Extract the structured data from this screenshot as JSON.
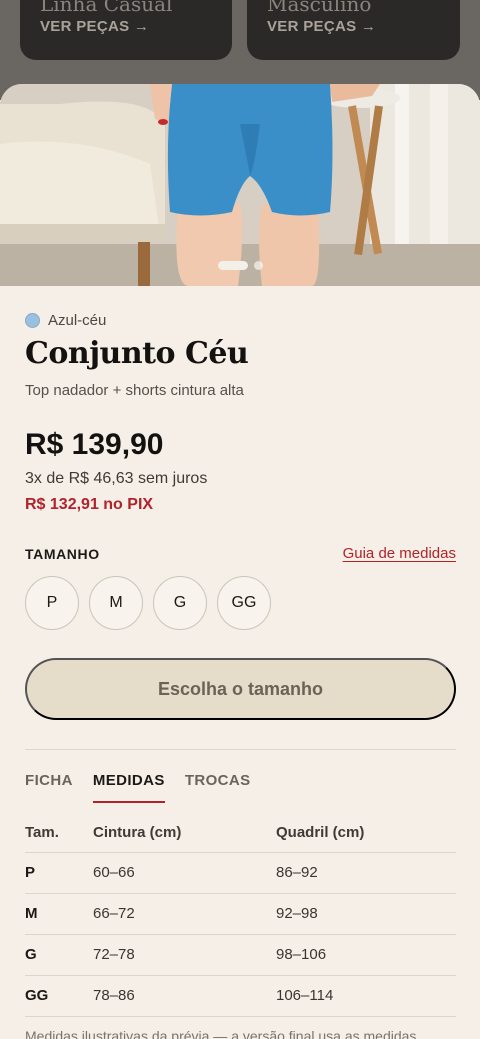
{
  "categories": [
    {
      "title": "Linha Casual",
      "link": "VER PEÇAS →"
    },
    {
      "title": "Masculino",
      "link": "VER PEÇAS →"
    }
  ],
  "gallery": {
    "slides": 2,
    "active": 0
  },
  "product": {
    "color_name": "Azul-céu",
    "color_hex": "#9ac0e0",
    "title": "Conjunto Céu",
    "subtitle": "Top nadador + shorts cintura alta",
    "price": "R$ 139,90",
    "installments": "3x de R$ 46,63 sem juros",
    "pix": "R$ 132,91 no PIX"
  },
  "sizes": {
    "label": "TAMANHO",
    "guide_link": "Guia de medidas",
    "options": [
      "P",
      "M",
      "G",
      "GG"
    ]
  },
  "cta": {
    "label": "Escolha o tamanho"
  },
  "tabs": [
    {
      "label": "FICHA",
      "active": false
    },
    {
      "label": "MEDIDAS",
      "active": true
    },
    {
      "label": "TROCAS",
      "active": false
    }
  ],
  "measurements": {
    "headers": [
      "Tam.",
      "Cintura (cm)",
      "Quadril (cm)"
    ],
    "rows": [
      [
        "P",
        "60–66",
        "86–92"
      ],
      [
        "M",
        "66–72",
        "92–98"
      ],
      [
        "G",
        "72–78",
        "98–106"
      ],
      [
        "GG",
        "78–86",
        "106–114"
      ]
    ],
    "footnote": "Medidas ilustrativas da prévia — a versão final usa as medidas"
  },
  "colors": {
    "accent": "#b0232b",
    "background": "#f5efe7",
    "cta_bg": "#e6dcca"
  }
}
